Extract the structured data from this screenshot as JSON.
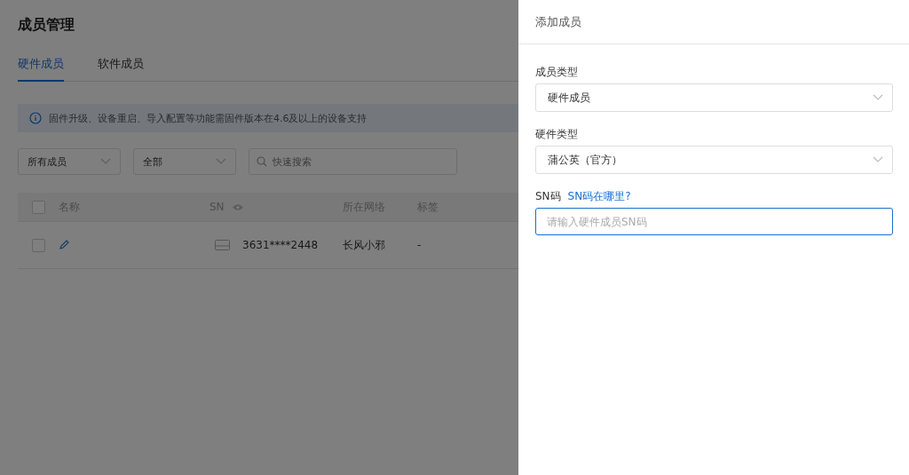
{
  "page": {
    "title": "成员管理",
    "tabs": [
      {
        "label": "硬件成员",
        "selected": true
      },
      {
        "label": "软件成员",
        "selected": false
      }
    ],
    "notice": "固件升级、设备重启、导入配置等功能需固件版本在4.6及以上的设备支持",
    "filters": {
      "member_filter": "所有成员",
      "scope_filter": "全部",
      "search": {
        "placeholder": "快速搜索"
      }
    },
    "table": {
      "select_all_checked": false,
      "columns": [
        "名称",
        "SN",
        "所在网络",
        "标签"
      ],
      "rows": [
        {
          "checked": false,
          "sn": "3631****2448",
          "network": "长风小邪",
          "tags": "-"
        }
      ]
    }
  },
  "drawer": {
    "title": "添加成员",
    "member_type": {
      "label": "成员类型",
      "value": "硬件成员"
    },
    "hardware_type": {
      "label": "硬件类型",
      "value": "蒲公英（官方）"
    },
    "sn": {
      "label": "SN码",
      "help_link": "SN码在哪里?",
      "placeholder": "请输入硬件成员SN码",
      "focused": true
    }
  }
}
